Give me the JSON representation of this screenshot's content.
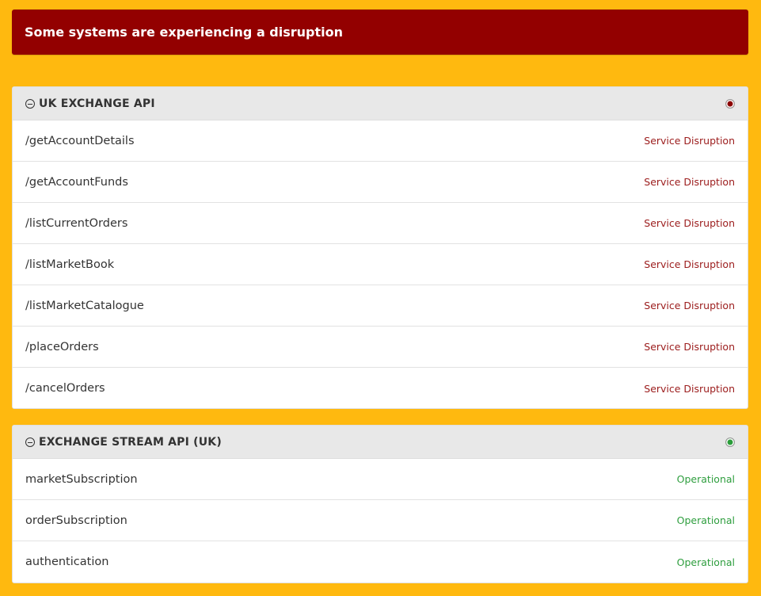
{
  "banner": {
    "message": "Some systems are experiencing a disruption",
    "color": "#930000"
  },
  "colors": {
    "background": "#FFB90F",
    "disruption": "#9b1b1b",
    "operational": "#2e9e3e",
    "dot_disruption": "#8b0000",
    "dot_operational": "#2a9d3a"
  },
  "groups": [
    {
      "title": "UK EXCHANGE API",
      "icon": "collapse-minus-icon",
      "status": "disruption",
      "components": [
        {
          "name": "/getAccountDetails",
          "status": "Service Disruption"
        },
        {
          "name": "/getAccountFunds",
          "status": "Service Disruption"
        },
        {
          "name": "/listCurrentOrders",
          "status": "Service Disruption"
        },
        {
          "name": "/listMarketBook",
          "status": "Service Disruption"
        },
        {
          "name": "/listMarketCatalogue",
          "status": "Service Disruption"
        },
        {
          "name": "/placeOrders",
          "status": "Service Disruption"
        },
        {
          "name": "/cancelOrders",
          "status": "Service Disruption"
        }
      ]
    },
    {
      "title": "EXCHANGE STREAM API (UK)",
      "icon": "collapse-minus-icon",
      "status": "operational",
      "components": [
        {
          "name": "marketSubscription",
          "status": "Operational"
        },
        {
          "name": "orderSubscription",
          "status": "Operational"
        },
        {
          "name": "authentication",
          "status": "Operational"
        }
      ]
    }
  ]
}
